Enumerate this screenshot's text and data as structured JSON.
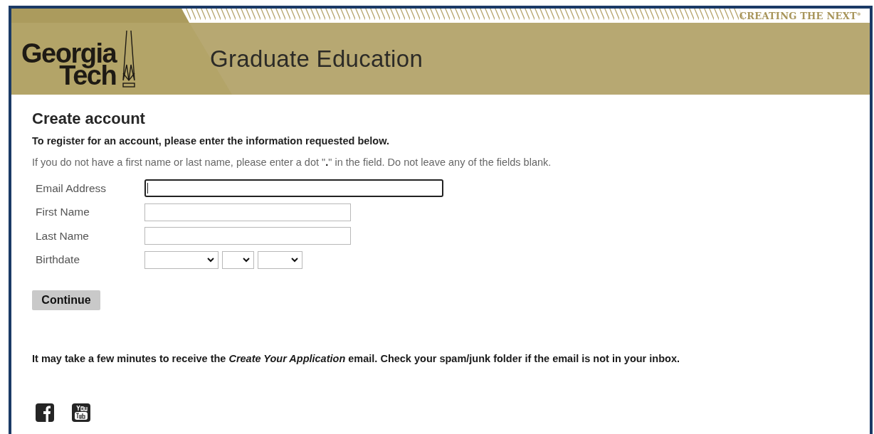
{
  "header": {
    "logo": {
      "line_1": "Georgia",
      "line_2": "Tech"
    },
    "tagline": "CREATING THE NEXT$^{®}$",
    "title": "Graduate Education"
  },
  "form": {
    "title": "Create account",
    "intro": "To register for an account, please enter the information requested below.",
    "hint": "If you do not have a first name or last name, please enter a dot \"**.**\" in the field. Do not leave any of the fields blank.",
    "fields": [
      {
        "label": "Email Address",
        "kind": "email",
        "focused": true
      },
      {
        "label": "First Name",
        "kind": "text",
        "focused": false
      },
      {
        "label": "Last Name",
        "kind": "text",
        "focused": false
      },
      {
        "label": "Birthdate",
        "kind": "date-selects"
      }
    ],
    "button": "Continue"
  },
  "note": "It may take a few minutes to receive the *Create Your Application* email. Check your spam/junk folder if the email is not in your inbox."
}
